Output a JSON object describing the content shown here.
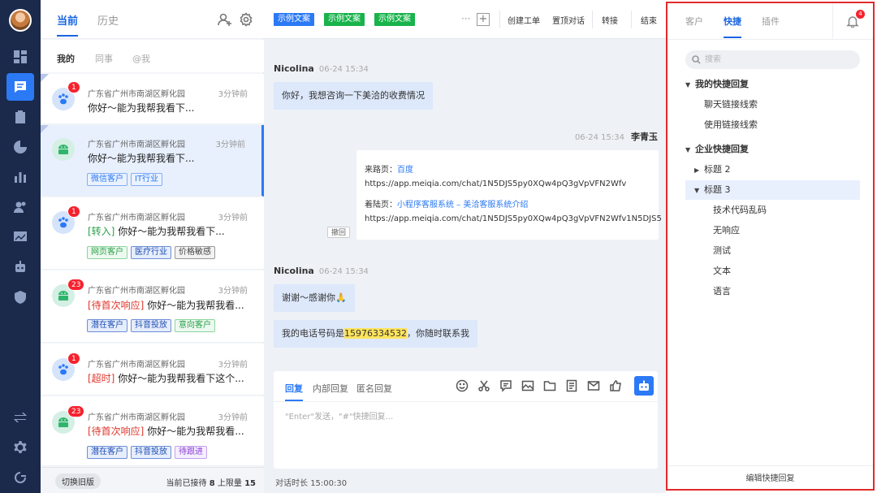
{
  "nav": {
    "items": [
      {
        "icon": "dashboard-icon"
      },
      {
        "icon": "chat-icon",
        "active": true
      },
      {
        "icon": "clipboard-icon"
      },
      {
        "icon": "pie-chart-icon"
      },
      {
        "icon": "bar-chart-icon"
      },
      {
        "icon": "users-icon"
      },
      {
        "icon": "line-chart-icon"
      },
      {
        "icon": "robot-icon"
      },
      {
        "icon": "shield-icon"
      }
    ],
    "bottom": [
      {
        "icon": "switch-icon"
      },
      {
        "icon": "gear-icon"
      },
      {
        "icon": "logout-icon"
      }
    ]
  },
  "list": {
    "tabs": [
      "当前",
      "历史"
    ],
    "sub_tabs": [
      "我的",
      "同事",
      "@我"
    ],
    "conversations": [
      {
        "location": "广东省广州市南湖区孵化园",
        "time": "3分钟前",
        "badge": "1",
        "avatar": "paw",
        "prefix": "",
        "message": "你好～能为我帮我看下...",
        "tags": []
      },
      {
        "location": "广东省广州市南湖区孵化园",
        "time": "3分钟前",
        "badge": "",
        "avatar": "droid",
        "prefix": "",
        "message": "你好～能为我帮我看下...",
        "tags": [
          {
            "text": "微信客户",
            "style": "blue"
          },
          {
            "text": "IT行业",
            "style": "blue"
          }
        ]
      },
      {
        "location": "广东省广州市南湖区孵化园",
        "time": "3分钟前",
        "badge": "1",
        "avatar": "paw",
        "prefix": "[转入]",
        "prefix_style": "g",
        "message": "你好～能为我帮我看下...",
        "tags": [
          {
            "text": "网页客户",
            "style": "green"
          },
          {
            "text": "医疗行业",
            "style": "bluebold"
          },
          {
            "text": "价格敏感",
            "style": "gray"
          }
        ]
      },
      {
        "location": "广东省广州市南湖区孵化园",
        "time": "3分钟前",
        "badge": "23",
        "avatar": "droid",
        "prefix": "[待首次响应]",
        "prefix_style": "r",
        "message": "你好～能为我帮我看...",
        "tags": [
          {
            "text": "潜在客户",
            "style": "bluebold"
          },
          {
            "text": "抖音投放",
            "style": "bluebold"
          },
          {
            "text": "意向客户",
            "style": "green"
          }
        ]
      },
      {
        "location": "广东省广州市南湖区孵化园",
        "time": "3分钟前",
        "badge": "1",
        "avatar": "paw",
        "prefix": "[超时]",
        "prefix_style": "r",
        "message": "你好～能为我帮我看下这个...",
        "tags": []
      },
      {
        "location": "广东省广州市南湖区孵化园",
        "time": "3分钟前",
        "badge": "23",
        "avatar": "droid",
        "prefix": "[待首次响应]",
        "prefix_style": "r",
        "message": "你好～能为我帮我看...",
        "tags": [
          {
            "text": "潜在客户",
            "style": "bluebold"
          },
          {
            "text": "抖音投放",
            "style": "bluebold"
          },
          {
            "text": "待跟进",
            "style": "purple"
          }
        ]
      }
    ],
    "footer": {
      "switch_label": "切换旧版",
      "stat_prefix": "当前已接待",
      "served": "8",
      "stat_mid": "上限量",
      "limit": "15"
    }
  },
  "chat": {
    "chips": [
      {
        "text": "示例文案",
        "style": "b"
      },
      {
        "text": "示例文案",
        "style": "g"
      },
      {
        "text": "示例文案",
        "style": "g"
      }
    ],
    "more": "···",
    "add": "+",
    "actions": [
      "创建工单",
      "置顶对话",
      "转接",
      "结束"
    ],
    "messages": {
      "m1_name": "Nicolina",
      "m1_date": "06-24 15:34",
      "m1_text": "你好，我想咨询一下美洽的收费情况",
      "agent_date": "06-24 15:34",
      "agent_name": "李青玉",
      "card": {
        "from_label": "来路页：",
        "from_link": "百度",
        "from_url": "https://app.meiqia.com/chat/1N5DJS5py0XQw4pQ3gVpVFN2Wfv",
        "land_label": "着陆页：",
        "land_link": "小程序客服系统 – 美洽客服系统介绍",
        "land_url": "https://app.meiqia.com/chat/1N5DJS5py0XQw4pQ3gVpVFN2Wfv1N5DJS5"
      },
      "recall": "撤回",
      "m2_name": "Nicolina",
      "m2_date": "06-24 15:34",
      "m2_text": "谢谢～感谢你🙏",
      "m3_pre": "我的电话号码是",
      "m3_phone": "15976334532",
      "m3_post": "，你随时联系我"
    },
    "composer": {
      "tabs": [
        "回复",
        "内部回复",
        "匿名回复"
      ],
      "tools": [
        "smile-icon",
        "scissors-icon",
        "comment-icon",
        "image-icon",
        "folder-icon",
        "document-icon",
        "mail-icon",
        "thumbs-up-icon"
      ],
      "placeholder": "\"Enter\"发送，\"#\"快捷回复..."
    },
    "duration_label": "对话时长",
    "duration": "15:00:30"
  },
  "panel": {
    "tabs": [
      "客户",
      "快捷",
      "插件"
    ],
    "bell_badge": "4",
    "search_placeholder": "搜索",
    "tree": [
      {
        "text": "我的快捷回复",
        "level": 0,
        "arrow": "▼",
        "bold": true
      },
      {
        "text": "聊天链接线索",
        "level": 1
      },
      {
        "text": "使用链接线索",
        "level": 1
      },
      {
        "text": "企业快捷回复",
        "level": 0,
        "arrow": "▼",
        "bold": true
      },
      {
        "text": "标题 2",
        "level": 1,
        "arrow": "▶"
      },
      {
        "text": "标题 3",
        "level": 1,
        "arrow": "▼",
        "highlight": true
      },
      {
        "text": "技术代码乱码",
        "level": 2
      },
      {
        "text": "无响应",
        "level": 2
      },
      {
        "text": "测试",
        "level": 2
      },
      {
        "text": "文本",
        "level": 2
      },
      {
        "text": "语言",
        "level": 2
      }
    ],
    "footer": "编辑快捷回复"
  }
}
